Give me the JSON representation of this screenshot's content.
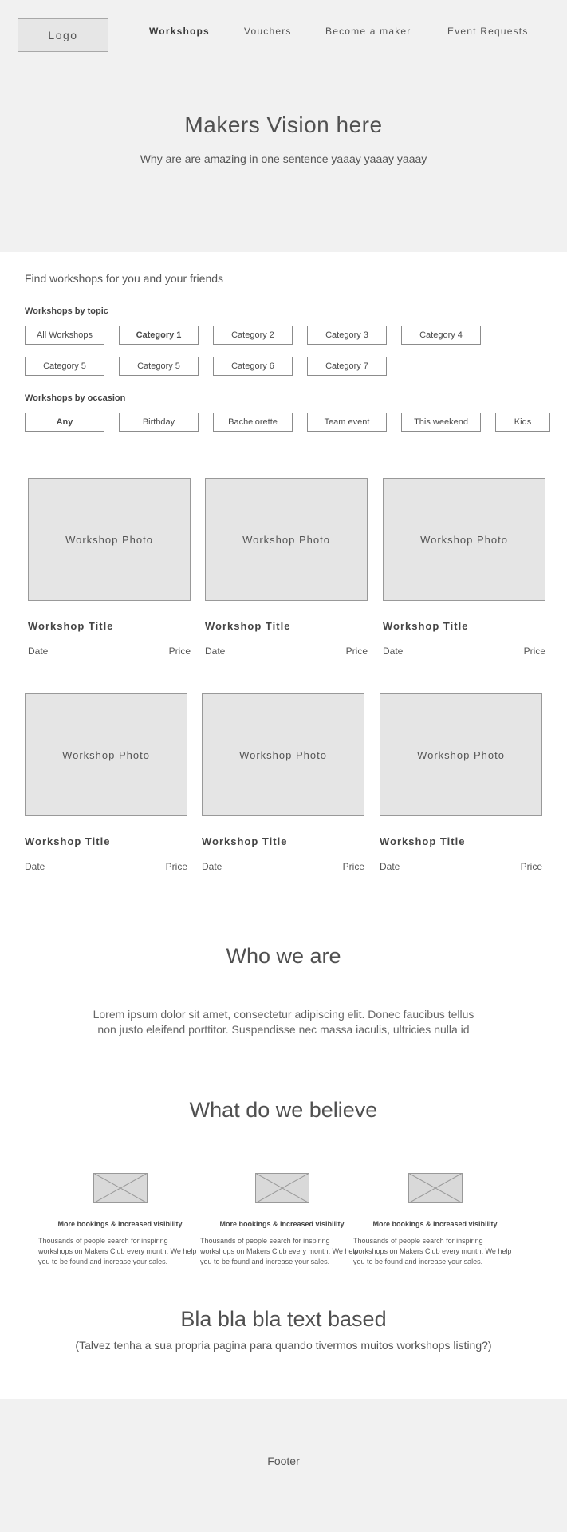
{
  "header": {
    "logo": "Logo",
    "nav": [
      "Workshops",
      "Vouchers",
      "Become a maker",
      "Event Requests"
    ]
  },
  "hero": {
    "title": "Makers Vision here",
    "subtitle": "Why are are amazing in one sentence yaaay yaaay yaaay"
  },
  "filters": {
    "intro": "Find workshops for you and your friends",
    "topic_label": "Workshops by topic",
    "topics": [
      "All Workshops",
      "Category 1",
      "Category 2",
      "Category 3",
      "Category 4",
      "Category 5",
      "Category 5",
      "Category 6",
      "Category 7"
    ],
    "occasion_label": "Workshops by occasion",
    "occasions": [
      "Any",
      "Birthday",
      "Bachelorette",
      "Team event",
      "This weekend",
      "Kids"
    ]
  },
  "workshops": [
    {
      "photo": "Workshop Photo",
      "title": "Workshop Title",
      "date": "Date",
      "price": "Price"
    },
    {
      "photo": "Workshop Photo",
      "title": "Workshop Title",
      "date": "Date",
      "price": "Price"
    },
    {
      "photo": "Workshop Photo",
      "title": "Workshop Title",
      "date": "Date",
      "price": "Price"
    },
    {
      "photo": "Workshop Photo",
      "title": "Workshop Title",
      "date": "Date",
      "price": "Price"
    },
    {
      "photo": "Workshop Photo",
      "title": "Workshop Title",
      "date": "Date",
      "price": "Price"
    },
    {
      "photo": "Workshop Photo",
      "title": "Workshop Title",
      "date": "Date",
      "price": "Price"
    }
  ],
  "who": {
    "title": "Who we are",
    "text": "Lorem ipsum dolor sit amet, consectetur adipiscing elit. Donec faucibus tellus non justo eleifend porttitor. Suspendisse nec massa iaculis, ultricies nulla id"
  },
  "believe": {
    "title": "What do we believe",
    "items": [
      {
        "heading": "More bookings & increased visibility",
        "text": "Thousands of people search for inspiring workshops on Makers Club every month. We help you to be found and increase your sales."
      },
      {
        "heading": "More bookings & increased visibility",
        "text": "Thousands of people search for inspiring workshops on Makers Club every month. We help you to be found and increase your sales."
      },
      {
        "heading": "More bookings & increased visibility",
        "text": "Thousands of people search for inspiring workshops on Makers Club every month. We help you to be found and increase your sales."
      }
    ]
  },
  "bla": {
    "title": "Bla bla bla text based",
    "subtitle": "(Talvez tenha a sua propria pagina para quando tivermos muitos workshops listing?)"
  },
  "footer": {
    "text": "Footer"
  }
}
